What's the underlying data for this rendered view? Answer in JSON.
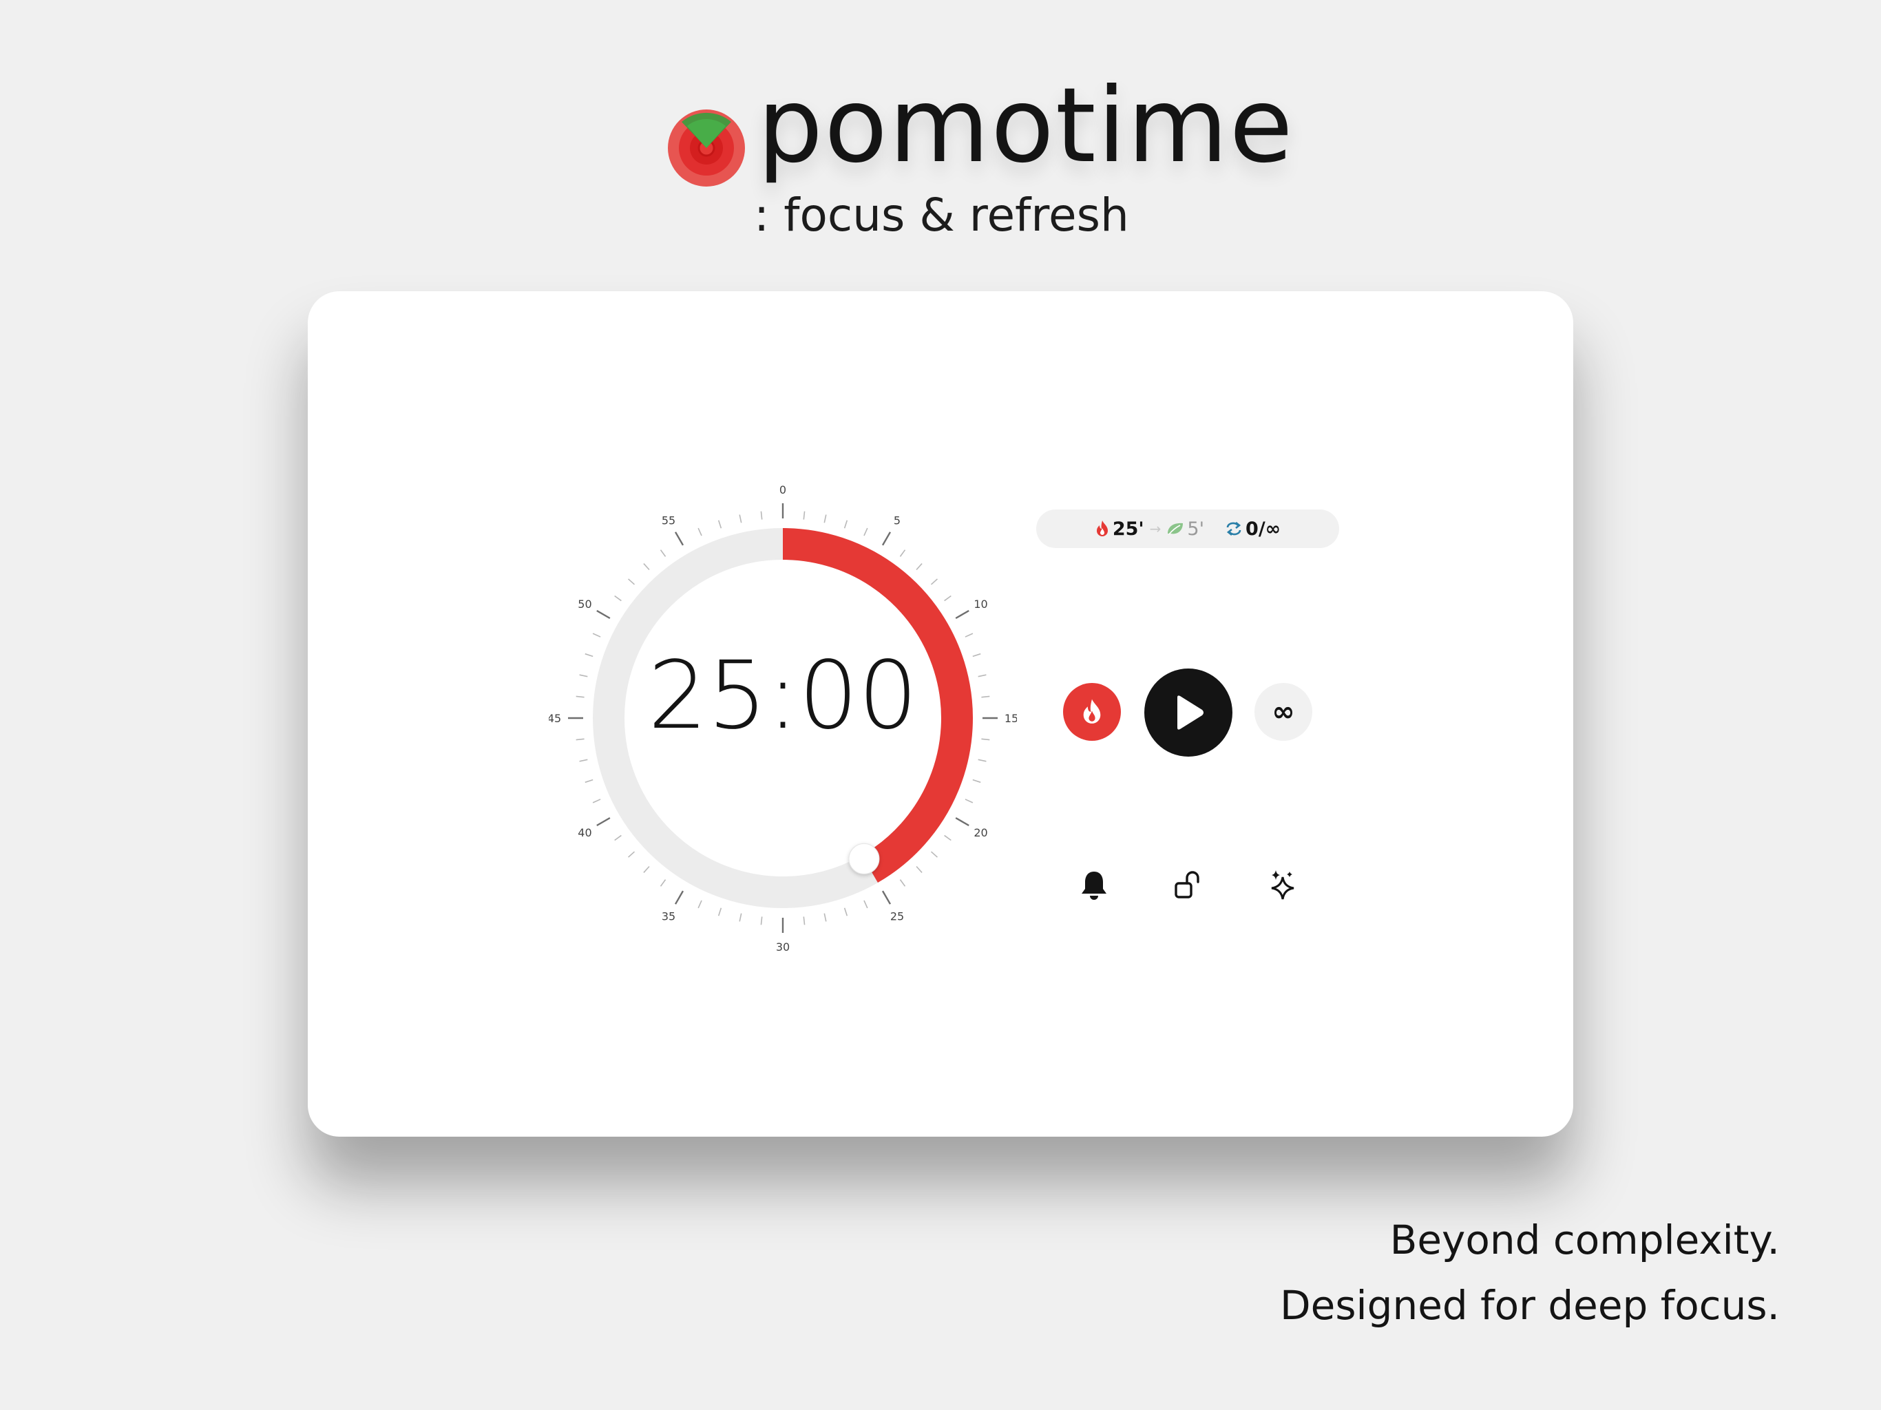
{
  "app": {
    "title": "pomotime",
    "subtitle": ": focus & refresh"
  },
  "timer": {
    "display": "25:00",
    "focus_minutes": 25,
    "dial_max_minutes": 60,
    "progress_fraction": 0.4167,
    "dial_labels": [
      "0",
      "5",
      "10",
      "15",
      "20",
      "25",
      "30",
      "35",
      "40",
      "45",
      "50",
      "55"
    ]
  },
  "status_pill": {
    "focus_label": "25'",
    "break_label": "5'",
    "cycles_label": "0/∞"
  },
  "controls": {
    "loop_label": "∞"
  },
  "tagline": {
    "line1": "Beyond complexity.",
    "line2": "Designed for deep focus."
  },
  "colors": {
    "accent": "#e53935",
    "dark": "#141414",
    "track": "#ececec",
    "leaf": "#8bc48a",
    "cycle": "#2a7fa8",
    "background": "#f0f0f0"
  },
  "icons": {
    "logo": "tomato-logo-icon",
    "focus": "flame-icon",
    "break": "leaf-icon",
    "cycles": "repeat-icon",
    "play": "play-icon",
    "notifications": "bell-icon",
    "lock": "unlocked-lock-icon",
    "extras": "sparkles-icon"
  }
}
